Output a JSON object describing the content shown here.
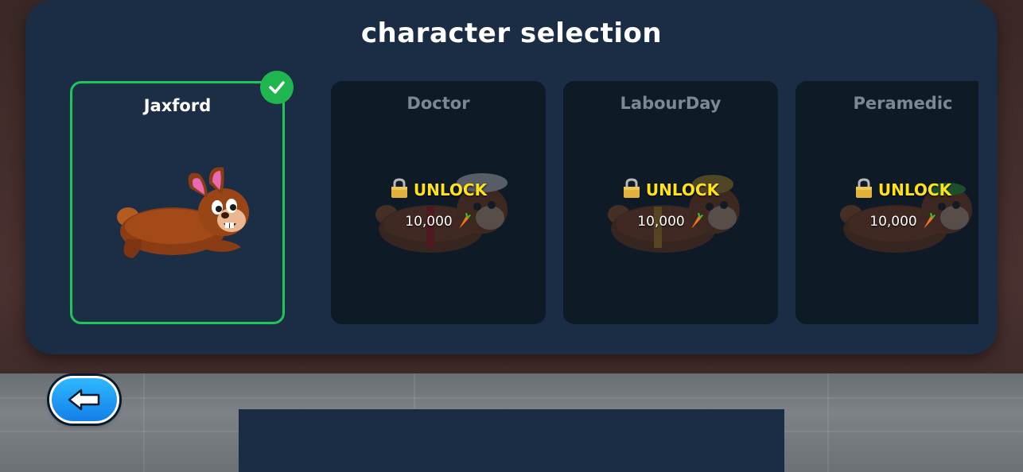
{
  "title": "character selection",
  "characters": [
    {
      "name": "Jaxford",
      "selected": true,
      "locked": false,
      "accessory": "none"
    },
    {
      "name": "Doctor",
      "selected": false,
      "locked": true,
      "unlock_label": "UNLOCK",
      "price": "10,000",
      "accessory": "doctor-cap"
    },
    {
      "name": "LabourDay",
      "selected": false,
      "locked": true,
      "unlock_label": "UNLOCK",
      "price": "10,000",
      "accessory": "hard-hat"
    },
    {
      "name": "Peramedic",
      "selected": false,
      "locked": true,
      "unlock_label": "UNLOCK",
      "price": "10,000",
      "accessory": "green-cap"
    }
  ],
  "icons": {
    "selected": "check-icon",
    "locked": "lock-icon",
    "currency": "carrot-icon",
    "back": "arrow-left-icon"
  },
  "colors": {
    "panel": "#1b2d45",
    "selected_border": "#1fc45a",
    "unlock_text": "#ffe21a",
    "back_button": "#1c9af5"
  }
}
